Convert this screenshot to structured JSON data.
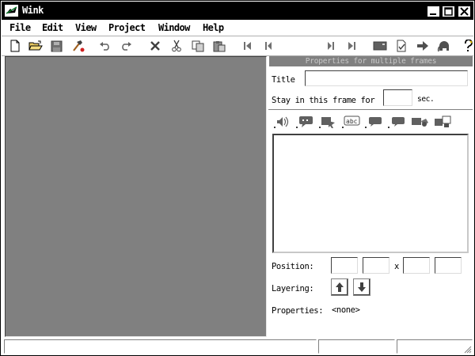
{
  "window": {
    "title": "Wink"
  },
  "menu": {
    "items": [
      {
        "label": "File"
      },
      {
        "label": "Edit"
      },
      {
        "label": "View"
      },
      {
        "label": "Project"
      },
      {
        "label": "Window"
      },
      {
        "label": "Help"
      }
    ]
  },
  "toolbar": {
    "buttons": [
      {
        "icon": "new-file-icon"
      },
      {
        "icon": "open-folder-icon"
      },
      {
        "icon": "save-icon"
      },
      {
        "icon": "render-hammer-icon"
      },
      {
        "icon": "undo-icon"
      },
      {
        "icon": "redo-icon"
      },
      {
        "icon": "delete-icon"
      },
      {
        "icon": "cut-icon"
      },
      {
        "icon": "copy-icon"
      },
      {
        "icon": "paste-icon"
      },
      {
        "icon": "first-frame-icon"
      },
      {
        "icon": "previous-frame-icon"
      },
      {
        "icon": "next-frame-icon"
      },
      {
        "icon": "last-frame-icon"
      },
      {
        "icon": "presentation-icon"
      },
      {
        "icon": "check-document-icon"
      },
      {
        "icon": "goto-arrow-icon"
      },
      {
        "icon": "elephant-icon"
      },
      {
        "icon": "help-icon"
      }
    ]
  },
  "panel": {
    "header": "Properties for multiple frames",
    "title_label": "Title",
    "title_value": "",
    "stay_label": "Stay in this frame for",
    "stay_value": "",
    "stay_unit": "sec.",
    "object_buttons": [
      {
        "icon": "add-audio-icon"
      },
      {
        "icon": "add-callout-icon"
      },
      {
        "icon": "add-button-icon"
      },
      {
        "icon": "add-text-icon"
      },
      {
        "icon": "add-box-icon"
      },
      {
        "icon": "add-box2-icon"
      },
      {
        "icon": "add-image-icon"
      },
      {
        "icon": "add-frame-image-icon"
      }
    ],
    "position_label": "Position:",
    "position_values": [
      "",
      "",
      "",
      ""
    ],
    "position_separator": "x",
    "layering_label": "Layering:",
    "properties_label": "Properties:",
    "properties_value": "<none>"
  },
  "status": {
    "cells": [
      "",
      "",
      ""
    ]
  },
  "colors": {
    "stage": "#808080",
    "panel_header": "#808080",
    "titlebar": "#000000"
  }
}
